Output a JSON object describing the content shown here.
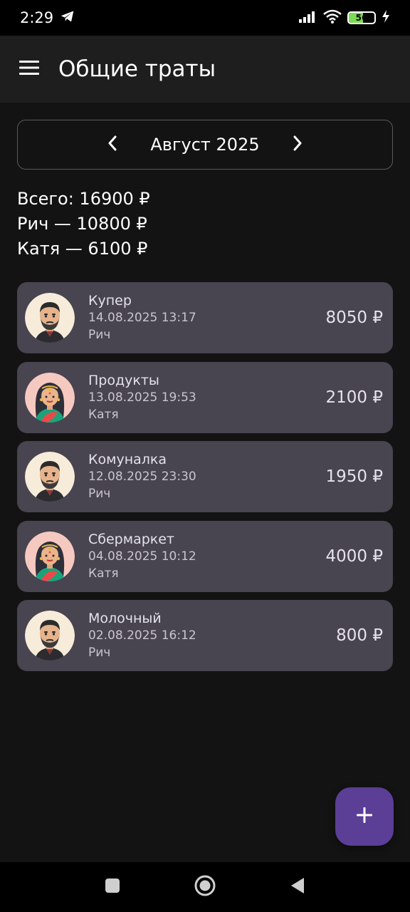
{
  "status_bar": {
    "time": "2:29",
    "battery_level": "56",
    "battery_color": "#7ed957"
  },
  "app_bar": {
    "title": "Общие траты",
    "menu_icon": "hamburger-menu-icon"
  },
  "month_selector": {
    "label": "Август 2025",
    "prev_icon": "chevron-left-icon",
    "next_icon": "chevron-right-icon"
  },
  "summary": {
    "total": "Всего: 16900 ₽",
    "person1": "Рич — 10800 ₽",
    "person2": "Катя — 6100 ₽"
  },
  "expenses": [
    {
      "title": "Купер",
      "date": "14.08.2025 13:17",
      "person": "Рич",
      "amount": "8050 ₽",
      "avatar": "man"
    },
    {
      "title": "Продукты",
      "date": "13.08.2025 19:53",
      "person": "Катя",
      "amount": "2100 ₽",
      "avatar": "woman"
    },
    {
      "title": "Комуналка",
      "date": "12.08.2025 23:30",
      "person": "Рич",
      "amount": "1950 ₽",
      "avatar": "man"
    },
    {
      "title": "Сбермаркет",
      "date": "04.08.2025 10:12",
      "person": "Катя",
      "amount": "4000 ₽",
      "avatar": "woman"
    },
    {
      "title": "Молочный",
      "date": "02.08.2025 16:12",
      "person": "Рич",
      "amount": "800 ₽",
      "avatar": "man"
    }
  ],
  "fab": {
    "icon": "plus-icon",
    "color": "#5b3e96"
  },
  "colors": {
    "background": "#131313",
    "app_bar": "#1e1e1e",
    "card": "#484450"
  }
}
